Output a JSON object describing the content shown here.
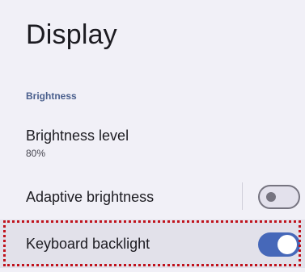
{
  "header": {
    "title": "Display"
  },
  "sections": {
    "brightness": {
      "header": "Brightness",
      "brightness_level": {
        "title": "Brightness level",
        "summary": "80%"
      },
      "adaptive_brightness": {
        "title": "Adaptive brightness",
        "enabled": false
      },
      "keyboard_backlight": {
        "title": "Keyboard backlight",
        "enabled": true,
        "highlighted": true
      }
    }
  },
  "colors": {
    "background": "#f1f0f7",
    "accent": "#4668b9",
    "section_header": "#4a5f8d",
    "highlight_outline": "#c0121c"
  }
}
